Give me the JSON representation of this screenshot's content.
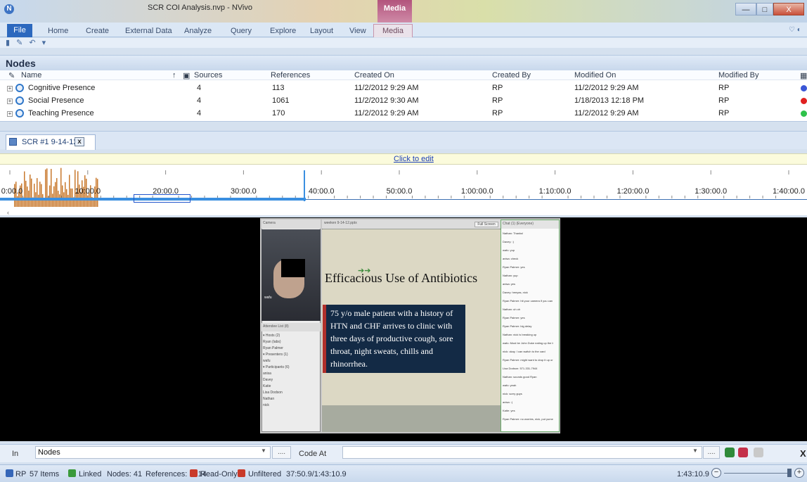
{
  "window": {
    "title": "SCR COI Analysis.nvp - NVivo",
    "context_tab": "Media",
    "minimize": "—",
    "maximize": "□",
    "close": "X"
  },
  "ribbon": {
    "file": "File",
    "tabs": [
      "Home",
      "Create",
      "External Data",
      "Analyze",
      "Query",
      "Explore",
      "Layout",
      "View"
    ],
    "media_tab": "Media",
    "help_icon": "♡ ◐"
  },
  "quick_access": {
    "icons": "▮ ✎ ↶ ▾"
  },
  "nodes_panel": {
    "title": "Nodes",
    "columns": [
      "Name",
      "Sources",
      "References",
      "Created On",
      "Created By",
      "Modified On",
      "Modified By"
    ],
    "rows": [
      {
        "name": "Cognitive Presence",
        "sources": "4",
        "references": "113",
        "created_on": "11/2/2012 9:29 AM",
        "created_by": "RP",
        "modified_on": "11/2/2012 9:29 AM",
        "modified_by": "RP",
        "color": "#3a56d6"
      },
      {
        "name": "Social Presence",
        "sources": "4",
        "references": "1061",
        "created_on": "11/2/2012 9:30 AM",
        "created_by": "RP",
        "modified_on": "1/18/2013 12:18 PM",
        "modified_by": "RP",
        "color": "#e02020"
      },
      {
        "name": "Teaching Presence",
        "sources": "4",
        "references": "170",
        "created_on": "11/2/2012 9:29 AM",
        "created_by": "RP",
        "modified_on": "11/2/2012 9:29 AM",
        "modified_by": "RP",
        "color": "#2ec24a"
      }
    ]
  },
  "document_tab": {
    "label": "SCR #1 9-14-12",
    "close": "x"
  },
  "timeline": {
    "click_to_edit": "Click to edit",
    "ticks": [
      {
        "label": "0:00.0",
        "frac": 0.0
      },
      {
        "label": "10:00.0",
        "frac": 0.1
      },
      {
        "label": "20:00.0",
        "frac": 0.2
      },
      {
        "label": "30:00.0",
        "frac": 0.3
      },
      {
        "label": "40:00.0",
        "frac": 0.4
      },
      {
        "label": "50:00.0",
        "frac": 0.5
      },
      {
        "label": "1:00:00.0",
        "frac": 0.6
      },
      {
        "label": "1:10:00.0",
        "frac": 0.7
      },
      {
        "label": "1:20:00.0",
        "frac": 0.8
      },
      {
        "label": "1:30:00.0",
        "frac": 0.9
      },
      {
        "label": "1:40:00.0",
        "frac": 1.0
      }
    ],
    "scroll_left": "‹"
  },
  "video": {
    "camera_header": "Camera",
    "camera_caption": "wafu",
    "attendee_header": "Attendee List (8)",
    "attendees": [
      "▾ Hosts (2)",
      "Ryan (labs)",
      "Ryan Palmer",
      "▾ Presenters (1)",
      "wafu",
      "▾ Participants (6)",
      "anisa",
      "Davey",
      "Katie",
      "Lisa Dodson",
      "Nathan",
      "nick"
    ],
    "slide_header": "weeken 9-14-12.pptx",
    "fullscreen": "Full Screen",
    "slide_title": "Efficacious Use of Antibiotics",
    "slide_body": "75 y/o male patient with a history of HTN and CHF arrives to clinic with three days of productive cough, sore throat, night sweats, chills and rhinorrhea.",
    "chat_header": "Chat (1) (Everyone)",
    "chat_lines": [
      "Nathan: Thanks!",
      "Davey: :)",
      "wafu: yup",
      "anisa: check",
      "Ryan Palmer: yes",
      "Nathan: yup",
      "anisa: yes",
      "Davey: heeyas, nick",
      "Ryan Palmer: hit your camera if you can",
      "Nathan: uh oh",
      "Ryan Palmer: yes",
      "Ryan Palmer: big delay",
      "Nathan: nick is breaking up",
      "wafu: Must be John Duke eating up the bandwidth",
      "nick: okay. I can switch to the card",
      "Ryan Palmer: might want to drop it up or reboot with the mic card",
      "Lisa Dodson: 571-331-7944",
      "Nathan: sounds good Ryan",
      "wafu: yeah",
      "nick: sorry guys",
      "anisa: :)",
      "Katie: yes",
      "Ryan Palmer: no worries, nick, put yume off and use your rig mod"
    ]
  },
  "code_bar": {
    "in_label": "In",
    "in_value": "Nodes",
    "ellipsis": "....",
    "code_at_label": "Code At",
    "close": "X"
  },
  "status_bar": {
    "user": "RP",
    "items": "57 Items",
    "linked": "Linked",
    "nodes": "Nodes: 41",
    "references": "References: 1714",
    "read_only": "Read-Only",
    "unfiltered": "Unfiltered",
    "position": "37:50.9/1:43:10.9",
    "time": "1:43:10.9",
    "zoom_minus": "−",
    "zoom_plus": "+"
  }
}
